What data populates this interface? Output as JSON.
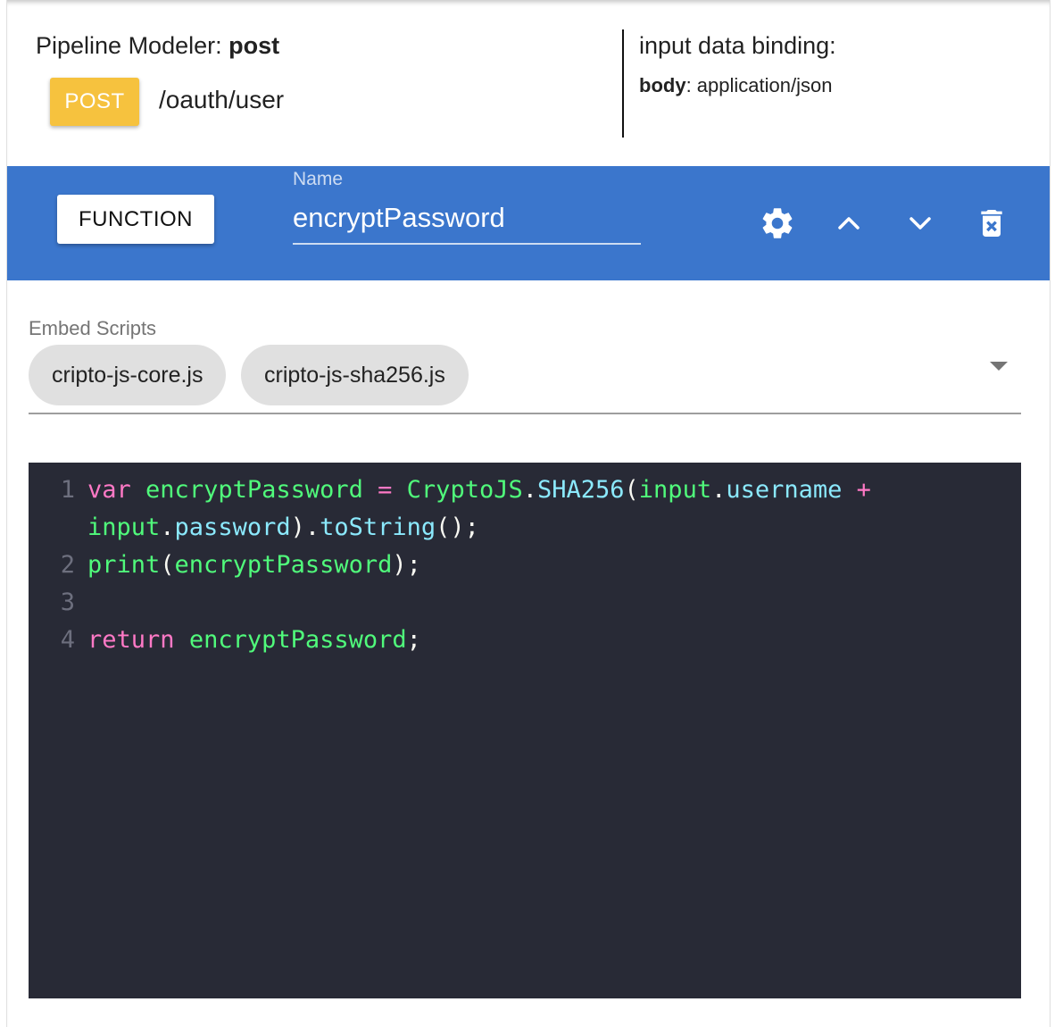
{
  "header": {
    "modeler_label": "Pipeline Modeler:",
    "modeler_method": "post",
    "method_badge": "POST",
    "endpoint_path": "/oauth/user",
    "binding_title": "input data binding:",
    "binding_key": "body",
    "binding_value": ": application/json"
  },
  "function_bar": {
    "type_button": "FUNCTION",
    "name_label": "Name",
    "name_value": "encryptPassword",
    "icons": [
      "gear-icon",
      "chevron-up-icon",
      "chevron-down-icon",
      "delete-icon"
    ],
    "background_color": "#3b76cc"
  },
  "embed_scripts": {
    "label": "Embed Scripts",
    "chips": [
      "cripto-js-core.js",
      "cripto-js-sha256.js"
    ]
  },
  "editor": {
    "lines": [
      {
        "number": "1",
        "tokens": [
          {
            "t": "var",
            "c": "kw"
          },
          {
            "t": " ",
            "c": "p"
          },
          {
            "t": "encryptPassword",
            "c": "id"
          },
          {
            "t": " = ",
            "c": "kw"
          },
          {
            "t": "CryptoJS",
            "c": "id"
          },
          {
            "t": ".",
            "c": "p"
          },
          {
            "t": "SHA256",
            "c": "prop"
          },
          {
            "t": "(",
            "c": "p"
          },
          {
            "t": "input",
            "c": "id"
          },
          {
            "t": ".",
            "c": "p"
          },
          {
            "t": "username",
            "c": "prop"
          },
          {
            "t": " +",
            "c": "kw"
          }
        ]
      },
      {
        "number": "",
        "tokens": [
          {
            "t": "input",
            "c": "id"
          },
          {
            "t": ".",
            "c": "p"
          },
          {
            "t": "password",
            "c": "prop"
          },
          {
            "t": ").",
            "c": "p"
          },
          {
            "t": "toString",
            "c": "prop"
          },
          {
            "t": "();",
            "c": "p"
          }
        ]
      },
      {
        "number": "2",
        "tokens": [
          {
            "t": "print",
            "c": "id"
          },
          {
            "t": "(",
            "c": "p"
          },
          {
            "t": "encryptPassword",
            "c": "id"
          },
          {
            "t": ");",
            "c": "p"
          }
        ]
      },
      {
        "number": "3",
        "tokens": []
      },
      {
        "number": "4",
        "tokens": [
          {
            "t": "return",
            "c": "kw"
          },
          {
            "t": " ",
            "c": "p"
          },
          {
            "t": "encryptPassword",
            "c": "id"
          },
          {
            "t": ";",
            "c": "p"
          }
        ]
      }
    ]
  }
}
